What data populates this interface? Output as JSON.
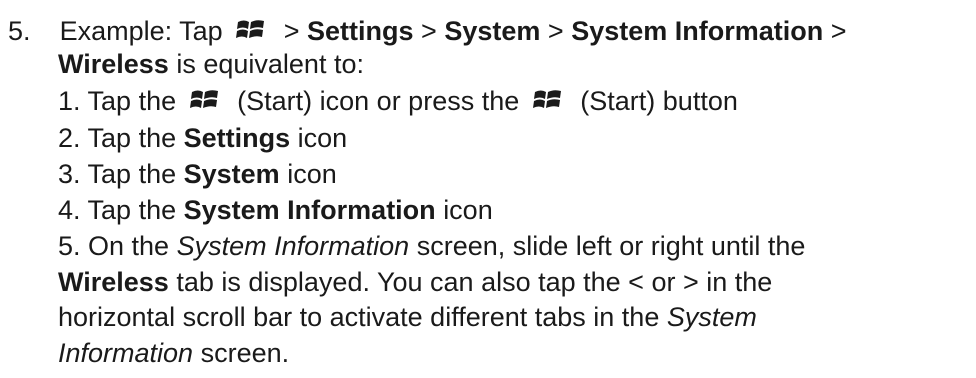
{
  "step": {
    "number": "5.",
    "line1": {
      "pre": "Example: Tap",
      "sep1": ">",
      "settings": "Settings",
      "sep2": ">",
      "system": "System",
      "sep3": ">",
      "sysinfo": "System Information",
      "sep4": ">"
    },
    "line2": {
      "wireless": "Wireless",
      "post": "is equivalent to:"
    }
  },
  "substeps": {
    "s1": {
      "pre": "1. Tap the",
      "mid": "(Start) icon or press the",
      "post": "(Start) button"
    },
    "s2": {
      "pre": "2. Tap the",
      "bold": "Settings",
      "post": "icon"
    },
    "s3": {
      "pre": "3. Tap the",
      "bold": "System",
      "post": "icon"
    },
    "s4": {
      "pre": "4. Tap the",
      "bold": "System Information",
      "post": "icon"
    },
    "s5": {
      "l1_pre": "5. On the",
      "l1_italic": "System Information",
      "l1_post": "screen, slide left or right until the",
      "l2_bold": "Wireless",
      "l2_post": "tab is displayed. You can also tap the < or > in the",
      "l3_pre": "horizontal scroll bar to activate different tabs in the",
      "l3_italic": "System",
      "l4_italic": "Information",
      "l4_post": "screen."
    }
  },
  "icons": {
    "start": "windows-start-logo"
  }
}
